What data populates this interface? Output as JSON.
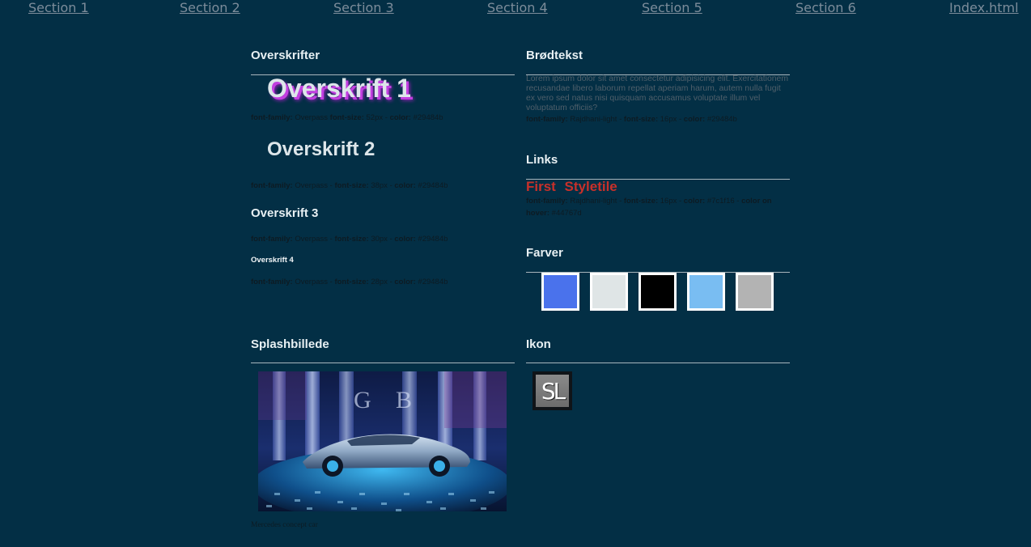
{
  "nav": {
    "items": [
      "Section 1",
      "Section 2",
      "Section 3",
      "Section 4",
      "Section 5",
      "Section 6",
      "Index.html"
    ]
  },
  "headings": {
    "title": "Overskrifter",
    "h1": {
      "text": "Overskrift 1",
      "ff_label": "font-family:",
      "ff": " Overpass ",
      "fs_label": "font-size:",
      "fs": " 52px - ",
      "color_label": "color:",
      "color": " #29484b"
    },
    "h2": {
      "text": "Overskrift 2",
      "ff_label": "font-family:",
      "ff": " Overpass - ",
      "fs_label": "font-size:",
      "fs": " 38px - ",
      "color_label": "color:",
      "color": " #29484b"
    },
    "h3": {
      "text": "Overskrift 3",
      "ff_label": "font-family:",
      "ff": " Overpass - ",
      "fs_label": "font-size:",
      "fs": " 30px - ",
      "color_label": "color:",
      "color": " #29484b"
    },
    "h4": {
      "text": "Overskrift 4",
      "ff_label": "font-family:",
      "ff": " Overpass - ",
      "fs_label": "font-size:",
      "fs": " 28px - ",
      "color_label": "color:",
      "color": " #29484b"
    }
  },
  "bodytext": {
    "title": "Brødtekst",
    "lorem": "Lorem ipsum dolor sit amet consectetur adipisicing elit. Exercitationem recusandae libero laborum repellat aperiam harum, autem nulla fugit ex vero sed natus nisi quisquam accusamus voluptate illum vel voluptatum officiis?",
    "ff_label": "font-family:",
    "ff": " Rajdhani-light - ",
    "fs_label": "font-size:",
    "fs": " 16px - ",
    "color_label": "color:",
    "color": " #29484b"
  },
  "links": {
    "title": "Links",
    "demo": "First Styletile",
    "ff_label": "font-family:",
    "ff": " Rajdhani-light - ",
    "fs_label": "font-size:",
    "fs": " 16px - ",
    "color_label": "color:",
    "color": " #7c1f16 - ",
    "hover_label": "color on hover:",
    "hover": " #44767d"
  },
  "colors": {
    "title": "Farver",
    "swatches": [
      "#4a72ec",
      "#dfe5e6",
      "#000000",
      "#79bdf2",
      "#b3b3b3"
    ]
  },
  "splash": {
    "title": "Splashbillede",
    "caption": "Mercedes concept car"
  },
  "icon": {
    "title": "Ikon",
    "letters": "SL"
  }
}
